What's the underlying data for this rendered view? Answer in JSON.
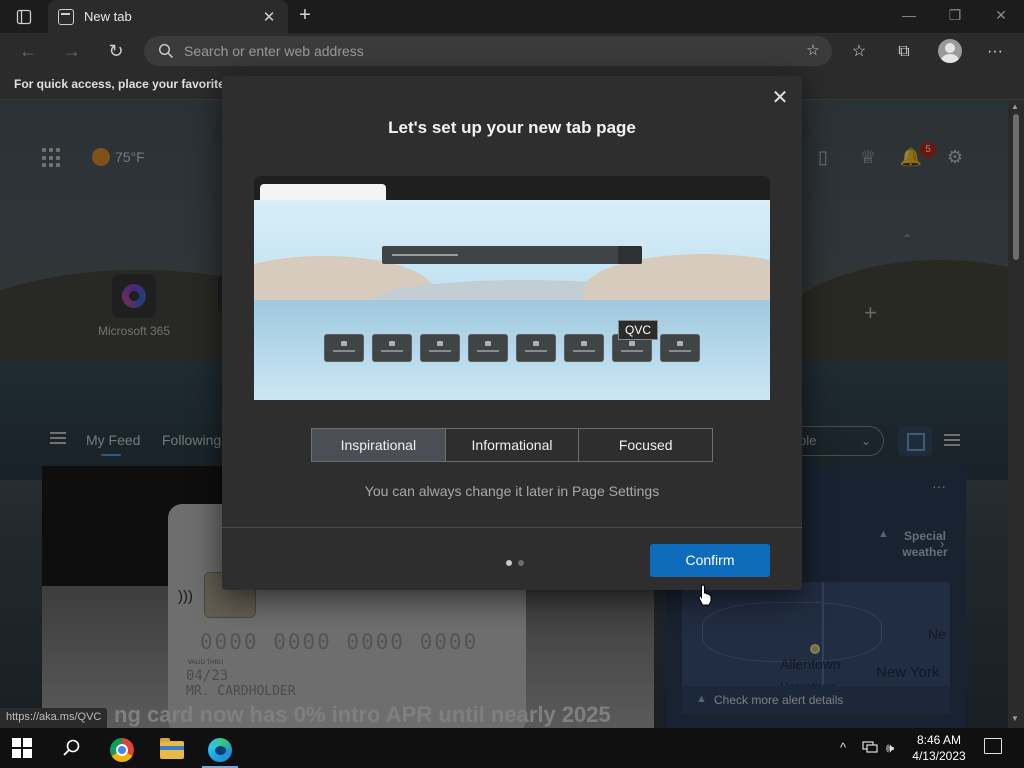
{
  "browser": {
    "tab_title": "New tab",
    "tab_close": "✕",
    "new_tab": "+",
    "minimize": "—",
    "restore": "❐",
    "close": "✕",
    "back": "←",
    "forward": "→",
    "refresh": "↻",
    "address_placeholder": "Search or enter web address",
    "favorites_bar_text": "For quick access, place your favorites h",
    "add_favorite": "☆",
    "favorites": "☆",
    "collections": "⧉",
    "more": "···"
  },
  "ntp": {
    "weather_temp": "75°F",
    "notification_count": "5",
    "phone_icon": "▯",
    "rewards_icon": "♕",
    "bell_icon": "🔔",
    "gear_icon": "⚙",
    "tile_label": "Microsoft 365",
    "add_tile": "+",
    "collapse": "⌃",
    "feed_tabs": [
      "My Feed",
      "Following"
    ],
    "feed_select": "ple",
    "headline": "ng card now has 0% intro APR until nearly 2025",
    "card": {
      "number": "0000 0000 0000 0000",
      "valid_thru": "VALID THRU",
      "date": "04/23",
      "holder": "MR. CARDHOLDER"
    },
    "weather_card": {
      "more": "···",
      "alert_title": "Special weather",
      "cities": [
        "Allentown",
        "New York",
        "Harrisburg",
        "Ne"
      ],
      "alert_details": "Check more alert details"
    },
    "status_url": "https://aka.ms/QVC"
  },
  "dialog": {
    "title": "Let's set up your new tab page",
    "close": "✕",
    "tooltip": "QVC",
    "options": [
      "Inspirational",
      "Informational",
      "Focused"
    ],
    "selected": "Inspirational",
    "hint": "You can always change it later in Page Settings",
    "confirm": "Confirm"
  },
  "taskbar": {
    "time": "8:46 AM",
    "date": "4/13/2023",
    "tray_chevron": "^",
    "volume": "🕪"
  },
  "colors": {
    "accent": "#0f6cbd",
    "segment_active": "#4b4f55",
    "dialog_bg": "#2e2e2e"
  }
}
